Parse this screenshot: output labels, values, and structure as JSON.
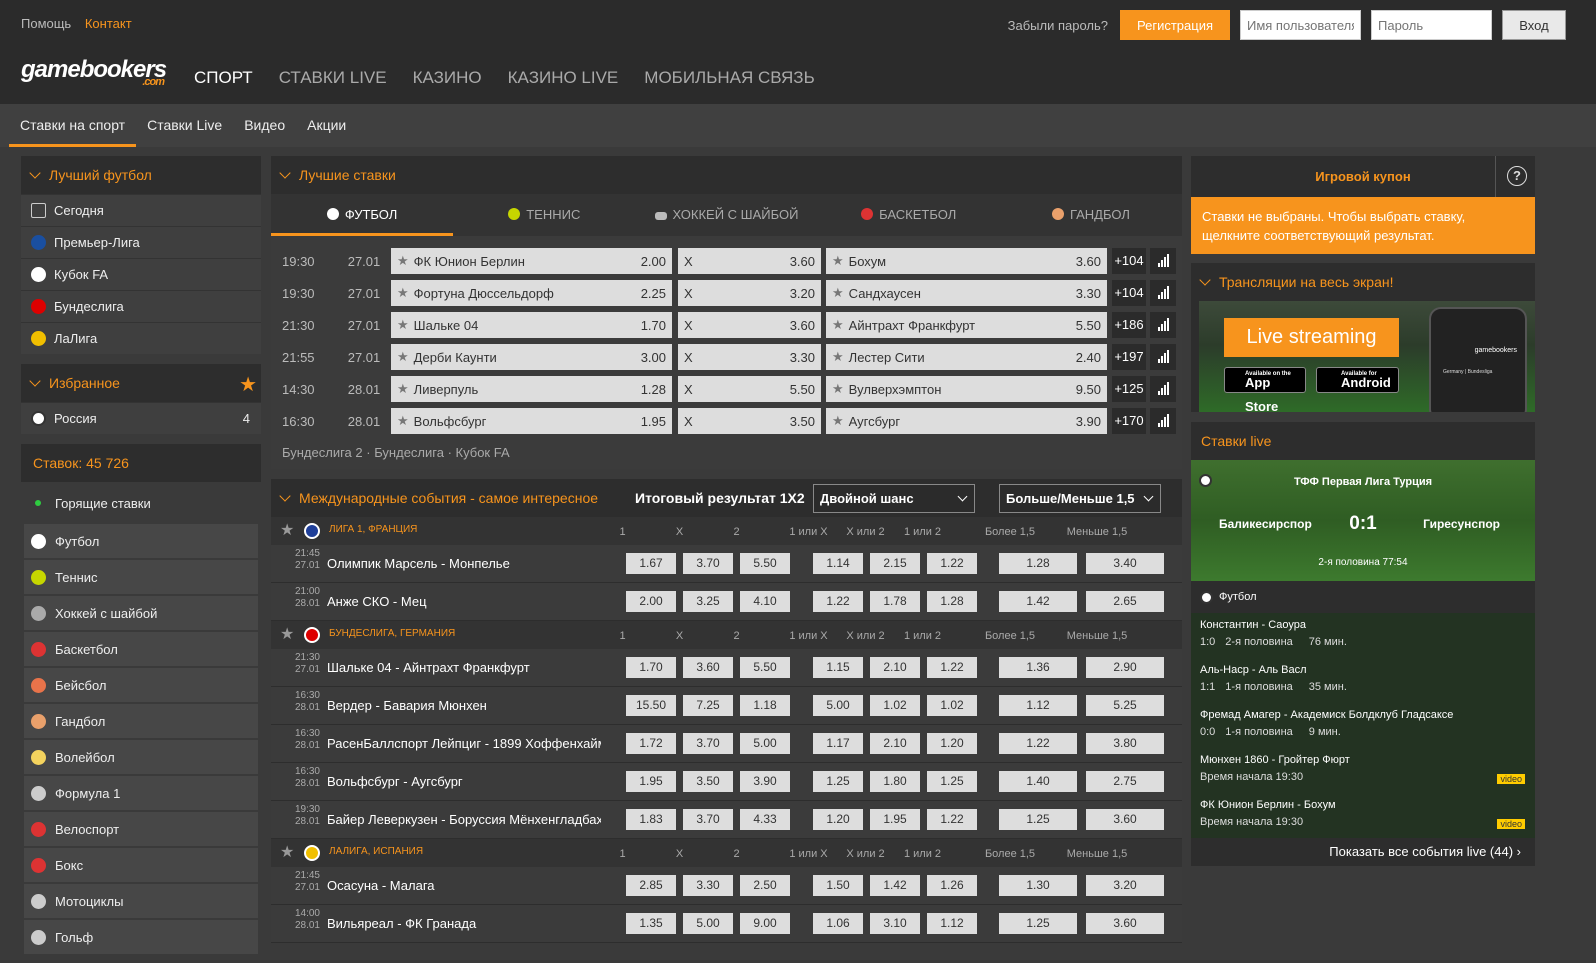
{
  "top": {
    "help": "Помощь",
    "contact": "Контакт",
    "forgot": "Забыли пароль?",
    "register": "Регистрация",
    "username_ph": "Имя пользователя",
    "password_ph": "Пароль",
    "login": "Вход"
  },
  "logo": {
    "text": "gamebookers",
    "com": ".com"
  },
  "mainnav": [
    "СПОРТ",
    "СТАВКИ LIVE",
    "КАЗИНО",
    "КАЗИНО LIVE",
    "МОБИЛЬНАЯ СВЯЗЬ"
  ],
  "subnav": [
    "Ставки на спорт",
    "Ставки Live",
    "Видео",
    "Акции"
  ],
  "left": {
    "best_title": "Лучший футбол",
    "best_items": [
      {
        "label": "Сегодня",
        "c": "#555"
      },
      {
        "label": "Премьер-Лига",
        "c": "#1a4fa0"
      },
      {
        "label": "Кубок FA",
        "c": "#fff"
      },
      {
        "label": "Бундеслига",
        "c": "#d00"
      },
      {
        "label": "ЛаЛига",
        "c": "#f1bf00"
      }
    ],
    "fav_title": "Избранное",
    "fav_items": [
      {
        "label": "Россия",
        "count": "4"
      }
    ],
    "stakes_title": "Ставок: 45 726",
    "sports": [
      "Горящие ставки",
      "Футбол",
      "Теннис",
      "Хоккей с шайбой",
      "Баскетбол",
      "Бейсбол",
      "Гандбол",
      "Волейбол",
      "Формула 1",
      "Велоспорт",
      "Бокс",
      "Мотоциклы",
      "Гольф"
    ]
  },
  "best_bets": {
    "title": "Лучшие ставки",
    "tabs": [
      "ФУТБОЛ",
      "ТЕННИС",
      "ХОККЕЙ С ШАЙБОЙ",
      "БАСКЕТБОЛ",
      "ГАНДБОЛ"
    ],
    "rows": [
      {
        "time": "19:30",
        "date": "27.01",
        "home": "ФК Юнион Берлин",
        "h": "2.00",
        "x": "X",
        "d": "3.60",
        "away": "Бохум",
        "a": "3.60",
        "more": "+104"
      },
      {
        "time": "19:30",
        "date": "27.01",
        "home": "Фортуна Дюссельдорф",
        "h": "2.25",
        "x": "X",
        "d": "3.20",
        "away": "Сандхаусен",
        "a": "3.30",
        "more": "+104"
      },
      {
        "time": "21:30",
        "date": "27.01",
        "home": "Шальке 04",
        "h": "1.70",
        "x": "X",
        "d": "3.60",
        "away": "Айнтрахт Франкфурт",
        "a": "5.50",
        "more": "+186"
      },
      {
        "time": "21:55",
        "date": "27.01",
        "home": "Дерби Каунти",
        "h": "3.00",
        "x": "X",
        "d": "3.30",
        "away": "Лестер Сити",
        "a": "2.40",
        "more": "+197"
      },
      {
        "time": "14:30",
        "date": "28.01",
        "home": "Ливерпуль",
        "h": "1.28",
        "x": "X",
        "d": "5.50",
        "away": "Вулверхэмптон",
        "a": "9.50",
        "more": "+125"
      },
      {
        "time": "16:30",
        "date": "28.01",
        "home": "Вольфсбург",
        "h": "1.95",
        "x": "X",
        "d": "3.50",
        "away": "Аугсбург",
        "a": "3.90",
        "more": "+170"
      }
    ],
    "leagues": [
      "Бундеслига 2",
      "Бундеслига",
      "Кубок FA"
    ]
  },
  "intl": {
    "title": "Международные события - самое интересное",
    "col1": "Итоговый результат 1X2",
    "sel1": "Двойной шанс",
    "sel2": "Больше/Меньше 1,5",
    "headers": [
      "1",
      "X",
      "2",
      "1 или X",
      "X или 2",
      "1 или 2",
      "Более 1,5",
      "Меньше 1,5"
    ],
    "groups": [
      {
        "league": "ЛИГА 1, ФРАНЦИЯ",
        "flag": "#1f3f99",
        "events": [
          {
            "t": "21:45",
            "d": "27.01",
            "name": "Олимпик Марсель - Монпелье",
            "o": [
              "1.67",
              "3.70",
              "5.50",
              "1.14",
              "2.15",
              "1.22",
              "1.28",
              "3.40"
            ]
          },
          {
            "t": "21:00",
            "d": "28.01",
            "name": "Анже СКО - Мец",
            "o": [
              "2.00",
              "3.25",
              "4.10",
              "1.22",
              "1.78",
              "1.28",
              "1.42",
              "2.65"
            ]
          }
        ]
      },
      {
        "league": "БУНДЕСЛИГА, ГЕРМАНИЯ",
        "flag": "#d00",
        "events": [
          {
            "t": "21:30",
            "d": "27.01",
            "name": "Шальке 04 - Айнтрахт Франкфурт",
            "o": [
              "1.70",
              "3.60",
              "5.50",
              "1.15",
              "2.10",
              "1.22",
              "1.36",
              "2.90"
            ]
          },
          {
            "t": "16:30",
            "d": "28.01",
            "name": "Вердер - Бавария Мюнхен",
            "o": [
              "15.50",
              "7.25",
              "1.18",
              "5.00",
              "1.02",
              "1.02",
              "1.12",
              "5.25"
            ]
          },
          {
            "t": "16:30",
            "d": "28.01",
            "name": "РасенБаллспорт Лейпциг - 1899 Хоффенхайм",
            "o": [
              "1.72",
              "3.70",
              "5.00",
              "1.17",
              "2.10",
              "1.20",
              "1.22",
              "3.80"
            ]
          },
          {
            "t": "16:30",
            "d": "28.01",
            "name": "Вольфсбург - Аугсбург",
            "o": [
              "1.95",
              "3.50",
              "3.90",
              "1.25",
              "1.80",
              "1.25",
              "1.40",
              "2.75"
            ]
          },
          {
            "t": "19:30",
            "d": "28.01",
            "name": "Байер Леверкузен - Боруссия Мёнхенгладбах",
            "o": [
              "1.83",
              "3.70",
              "4.33",
              "1.20",
              "1.95",
              "1.22",
              "1.25",
              "3.60"
            ]
          }
        ]
      },
      {
        "league": "ЛАЛИГА, ИСПАНИЯ",
        "flag": "#f1bf00",
        "events": [
          {
            "t": "21:45",
            "d": "27.01",
            "name": "Осасуна - Малага",
            "o": [
              "2.85",
              "3.30",
              "2.50",
              "1.50",
              "1.42",
              "1.26",
              "1.30",
              "3.20"
            ]
          },
          {
            "t": "14:00",
            "d": "28.01",
            "name": "Вильяреал - ФК Гранада",
            "o": [
              "1.35",
              "5.00",
              "9.00",
              "1.06",
              "3.10",
              "1.12",
              "1.25",
              "3.60"
            ]
          }
        ]
      }
    ]
  },
  "right": {
    "coupon_title": "Игровой купон",
    "coupon_help": "?",
    "coupon_text": "Ставки не выбраны. Чтобы выбрать ставку, щелкните соответствующий результат.",
    "stream_title": "Трансляции на весь экран!",
    "live_streaming": "Live streaming",
    "appstore_small": "Available on the",
    "appstore": "App Store",
    "android_small": "Available for",
    "android": "Android",
    "phone_logo": "gamebookers",
    "phone_text": "Germany | Bundesliga",
    "live_title": "Ставки live",
    "card": {
      "league": "ТФФ Первая Лига Турция",
      "home": "Баликесирспор",
      "score": "0:1",
      "away": "Гиресунспор",
      "status": "2-я половина  77:54"
    },
    "sport": "Футбол",
    "events": [
      {
        "name": "Константин - Саоура",
        "score": "1:0",
        "period": "2-я половина",
        "min": "76 мин.",
        "video": ""
      },
      {
        "name": "Аль-Наср - Аль Васл",
        "score": "1:1",
        "period": "1-я половина",
        "min": "35 мин.",
        "video": ""
      },
      {
        "name": "Фремад Амагер - Академиск Болдклуб Гладсаксе",
        "score": "0:0",
        "period": "1-я половина",
        "min": "9 мин.",
        "video": ""
      },
      {
        "name": "Мюнхен 1860 - Гройтер Фюрт",
        "score": "",
        "period": "Время начала 19:30",
        "min": "",
        "video": "video"
      },
      {
        "name": "ФК Юнион Берлин - Бохум",
        "score": "",
        "period": "Время начала 19:30",
        "min": "",
        "video": "video"
      }
    ],
    "show_all": "Показать все события live (44)"
  }
}
